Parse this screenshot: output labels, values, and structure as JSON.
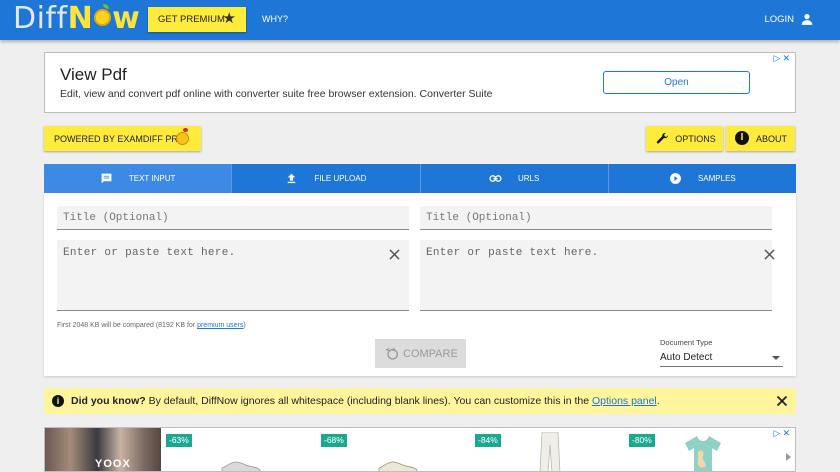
{
  "header": {
    "logo_prefix": "Diff",
    "logo_o": "N",
    "logo_suffix": "w",
    "premium_label": "GET PREMIUM",
    "why_label": "WHY?",
    "login_label": "LOGIN"
  },
  "ad_top": {
    "title": "View Pdf",
    "description": "Edit, view and convert pdf online with converter suite free browser extension. Converter Suite",
    "cta": "Open",
    "marks": "▷✕"
  },
  "toolbar": {
    "powered_label": "POWERED BY EXAMDIFF PRO",
    "options_label": "OPTIONS",
    "about_label": "ABOUT"
  },
  "tabs": [
    {
      "label": "TEXT INPUT",
      "icon": "message-icon"
    },
    {
      "label": "FILE UPLOAD",
      "icon": "upload-icon"
    },
    {
      "label": "URLS",
      "icon": "link-icon"
    },
    {
      "label": "SAMPLES",
      "icon": "play-icon"
    }
  ],
  "editor": {
    "title_placeholder": "Title (Optional)",
    "text_placeholder": "Enter or paste text here.",
    "note_prefix": "First 2048 KB will be compared (8192 KB for ",
    "note_link": "premium users",
    "note_suffix": ")",
    "compare_label": "COMPARE",
    "doc_type_label": "Document Type",
    "doc_type_value": "Auto Detect"
  },
  "tip": {
    "lead": "Did you know?",
    "text": " By default, DiffNow ignores all whitespace (including blank lines). You can customize this in the ",
    "link": "Options panel",
    "end": "."
  },
  "ad_bottom": {
    "brand": "YOOX",
    "marks": "▷✕",
    "discounts": [
      "-63%",
      "-68%",
      "-84%",
      "-80%"
    ]
  },
  "colors": {
    "header_blue": "#1e76d6",
    "accent_yellow": "#ffeb3b",
    "tip_yellow": "#fff59d",
    "discount_teal": "#1aa891"
  }
}
